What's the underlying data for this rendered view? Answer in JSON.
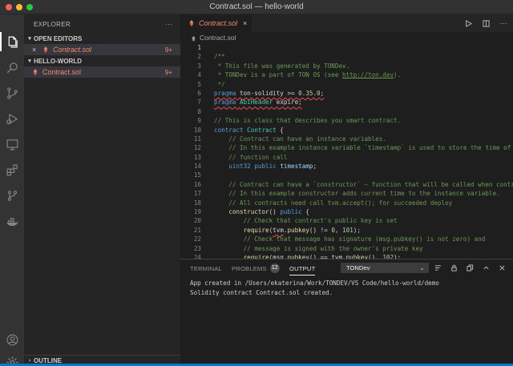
{
  "window": {
    "title": "Contract.sol — hello-world"
  },
  "activity_bar": {
    "icons": [
      "files-icon",
      "search-icon",
      "source-control-icon",
      "run-debug-icon",
      "remote-explorer-icon",
      "extensions-icon",
      "git-graph-icon",
      "docker-icon",
      "account-icon",
      "settings-gear-icon"
    ]
  },
  "sidebar": {
    "title": "EXPLORER",
    "more": "···",
    "open_editors": {
      "label": "OPEN EDITORS",
      "items": [
        {
          "close": "×",
          "name": "Contract.sol",
          "count": "9+"
        }
      ]
    },
    "workspace": {
      "label": "HELLO-WORLD",
      "items": [
        {
          "name": "Contract.sol",
          "count": "9+"
        }
      ]
    },
    "outline": {
      "label": "OUTLINE"
    }
  },
  "editor": {
    "tab": {
      "label": "Contract.sol",
      "close": "×"
    },
    "breadcrumb": "Contract.sol",
    "actions": [
      "run-icon",
      "split-editor-icon",
      "more-icon"
    ],
    "lines": [
      {
        "n": "1",
        "html": ""
      },
      {
        "n": "2",
        "html": "<span class='c'>/**</span>"
      },
      {
        "n": "3",
        "html": "<span class='c'> * This file was generated by TONDev.</span>"
      },
      {
        "n": "4",
        "html": "<span class='c'> * TONDev is a part of TON OS (see <span class='u'>http://ton.dev</span>).</span>"
      },
      {
        "n": "5",
        "html": "<span class='c'> */</span>"
      },
      {
        "n": "6",
        "html": "<span class='sq'><span class='k'>pragma</span> ton-solidity &gt;= <span class='n'>0.35.0</span>;</span>"
      },
      {
        "n": "7",
        "html": "<span class='sq'><span class='k'>pragma</span> <span class='t'>AbiHeader</span> expire;</span>"
      },
      {
        "n": "8",
        "html": ""
      },
      {
        "n": "9",
        "html": "<span class='c'>// This is class that describes you smart contract.</span>"
      },
      {
        "n": "10",
        "html": "<span class='k'>contract</span> <span class='t'>Contract</span> {"
      },
      {
        "n": "11",
        "html": "    <span class='c'>// Contract can have an instance variables.</span>"
      },
      {
        "n": "12",
        "html": "    <span class='c'>// In this example instance variable `timestamp` is used to store the time of</span>"
      },
      {
        "n": "13",
        "html": "    <span class='c'>// function call</span>"
      },
      {
        "n": "14",
        "html": "    <span class='k'>uint32</span> <span class='k'>public</span> <span class='v'>timestamp</span>;"
      },
      {
        "n": "15",
        "html": ""
      },
      {
        "n": "16",
        "html": "    <span class='c'>// Contract can have a `constructor` – function that will be called when contr</span>"
      },
      {
        "n": "17",
        "html": "    <span class='c'>// In this example constructor adds current time to the instance variable.</span>"
      },
      {
        "n": "18",
        "html": "    <span class='c'>// All contracts need call tvm.accept(); for succeeded deploy</span>"
      },
      {
        "n": "19",
        "html": "    <span class='f'>constructor</span>() <span class='k'>public</span> {"
      },
      {
        "n": "20",
        "html": "        <span class='c'>// Check that contract's public key is set</span>"
      },
      {
        "n": "21",
        "html": "        <span class='f'>require</span>(<span class='sq'>tvm</span>.<span class='f'>pubkey</span>() != <span class='n'>0</span>, <span class='n'>101</span>);"
      },
      {
        "n": "22",
        "html": "        <span class='c'>// Check that message has signature (msg.pubkey() is not zero) and</span>"
      },
      {
        "n": "23",
        "html": "        <span class='c'>// message is signed with the owner's private key</span>"
      },
      {
        "n": "24",
        "html": "        <span class='f'>require</span>(msg.<span class='f'>pubkey</span>() == tvm.<span class='f'>pubkey</span>(), <span class='n'>102</span>);"
      }
    ]
  },
  "panel": {
    "tabs": [
      {
        "label": "TERMINAL"
      },
      {
        "label": "PROBLEMS",
        "badge": "12"
      },
      {
        "label": "OUTPUT",
        "active": true
      }
    ],
    "channel": "TONDev",
    "icons": [
      "filter-list-icon",
      "lock-icon",
      "copy-icon",
      "maximize-icon",
      "close-icon"
    ],
    "output": [
      "App created in /Users/ekaterina/Work/TONDEV/VS Code/hello-world/demo",
      "Solidity contract Contract.sol created."
    ]
  },
  "colors": {
    "accent": "#007acc",
    "error": "#f48771",
    "sidebar": "#252526",
    "editor": "#1e1e1e"
  }
}
